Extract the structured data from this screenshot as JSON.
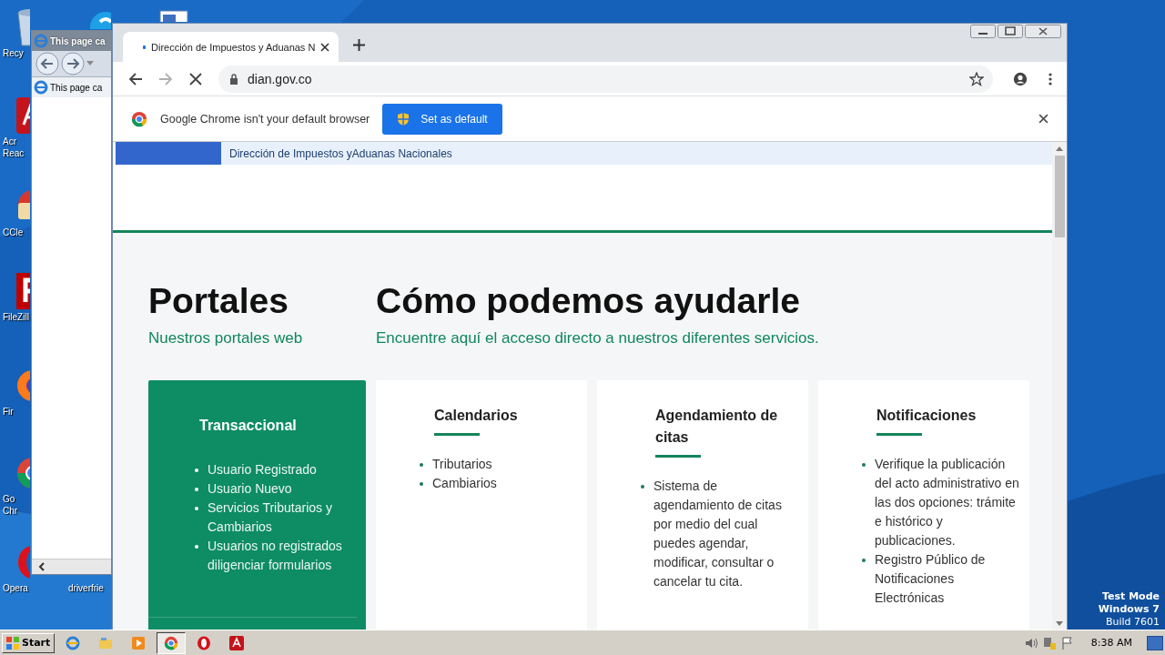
{
  "desktop": {
    "icons": [
      {
        "kind": "recycle",
        "label_lines": [
          "Recy"
        ]
      },
      {
        "kind": "skype"
      },
      {
        "kind": "document"
      },
      {
        "kind": "acrobat",
        "label_lines": [
          "Acr",
          "Reac"
        ]
      },
      {
        "kind": "ccleaner",
        "label_lines": [
          "CCle"
        ]
      },
      {
        "kind": "filezilla",
        "label_lines": [
          "FileZill"
        ]
      },
      {
        "kind": "firefox",
        "label_lines": [
          "Fir"
        ]
      },
      {
        "kind": "chrome",
        "label_lines": [
          "Go",
          "Chr"
        ]
      },
      {
        "kind": "opera",
        "label_lines": [
          "Opera"
        ]
      },
      {
        "kind": "none",
        "label_lines": [
          "driverfrie"
        ]
      }
    ],
    "test_mode_lines": [
      "Test Mode",
      "Windows 7",
      "Build 7601"
    ]
  },
  "ie_window": {
    "title": "This page ca",
    "tab": "This page ca"
  },
  "browser": {
    "tab": {
      "title": "Dirección de Impuestos y Aduanas N",
      "loading": true
    },
    "address": "dian.gov.co",
    "infobar": {
      "message": "Google Chrome isn't your default browser",
      "button": "Set as default"
    },
    "page": {
      "top_band": "Dirección de Impuestos yAduanas Nacionales",
      "sections": [
        {
          "title": "Portales",
          "subtitle": "Nuestros portales web"
        },
        {
          "title": "Cómo podemos ayudarle",
          "subtitle": "Encuentre aquí el acceso directo a nuestros diferentes servicios."
        }
      ],
      "cards": [
        {
          "title": "Transaccional",
          "highlighted": true,
          "items": [
            "Usuario Registrado",
            "Usuario Nuevo",
            "Servicios Tributarios y Cambiarios",
            "Usuarios no registrados diligenciar formularios"
          ]
        },
        {
          "title": "Calendarios",
          "highlighted": false,
          "items": [
            "Tributarios",
            "Cambiarios"
          ]
        },
        {
          "title": "Agendamiento de citas",
          "highlighted": false,
          "items": [
            "Sistema de agendamiento de citas por medio del cual puedes agendar, modificar, consultar o cancelar tu cita."
          ]
        },
        {
          "title": "Notificaciones",
          "highlighted": false,
          "items": [
            "Verifique la publicación del acto administrativo en las dos opciones: trámite e histórico y publicaciones.",
            "Registro Público de Notificaciones Electrónicas"
          ]
        }
      ]
    }
  },
  "taskbar": {
    "start": "Start",
    "apps": [
      {
        "kind": "ie",
        "active": false
      },
      {
        "kind": "explorer",
        "active": false
      },
      {
        "kind": "media",
        "active": false
      },
      {
        "kind": "chrome",
        "active": true
      },
      {
        "kind": "opera",
        "active": false
      },
      {
        "kind": "acrobat",
        "active": false
      }
    ],
    "clock": "8:38 AM"
  }
}
